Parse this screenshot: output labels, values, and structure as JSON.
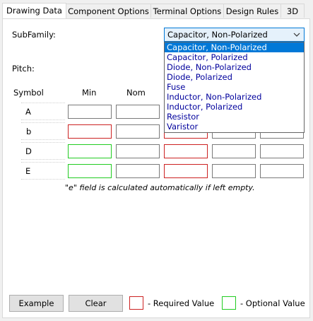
{
  "tabs": [
    {
      "label": "Drawing Data",
      "active": true
    },
    {
      "label": "Component Options",
      "active": false
    },
    {
      "label": "Terminal Options",
      "active": false
    },
    {
      "label": "Design Rules",
      "active": false
    },
    {
      "label": "3D",
      "active": false
    }
  ],
  "form": {
    "subfamily_label": "SubFamily:",
    "pitch_label": "Pitch:",
    "subfamily_value": "Capacitor, Non-Polarized",
    "subfamily_options": [
      "Capacitor, Non-Polarized",
      "Capacitor, Polarized",
      "Diode, Non-Polarized",
      "Diode, Polarized",
      "Fuse",
      "Inductor, Non-Polarized",
      "Inductor, Polarized",
      "Resistor",
      "Varistor"
    ],
    "selected_option_index": 0
  },
  "table": {
    "headers": {
      "symbol": "Symbol",
      "min": "Min",
      "nom": "Nom"
    },
    "rows": [
      {
        "symbol": "A",
        "cells": [
          "default",
          "default",
          "default",
          "default",
          "default"
        ]
      },
      {
        "symbol": "b",
        "cells": [
          "required",
          "default",
          "required",
          "default",
          "default"
        ]
      },
      {
        "symbol": "D",
        "cells": [
          "optional",
          "default",
          "required",
          "default",
          "default"
        ]
      },
      {
        "symbol": "E",
        "cells": [
          "optional",
          "default",
          "required",
          "default",
          "default"
        ]
      }
    ],
    "note": "\"e\" field is calculated automatically if left empty."
  },
  "footer": {
    "example_label": "Example",
    "clear_label": "Clear",
    "required_legend": "- Required Value",
    "optional_legend": "- Optional Value"
  },
  "colors": {
    "required": "#cc2222",
    "optional": "#22cc22",
    "accent": "#0078d7",
    "option_text": "#00009c"
  }
}
